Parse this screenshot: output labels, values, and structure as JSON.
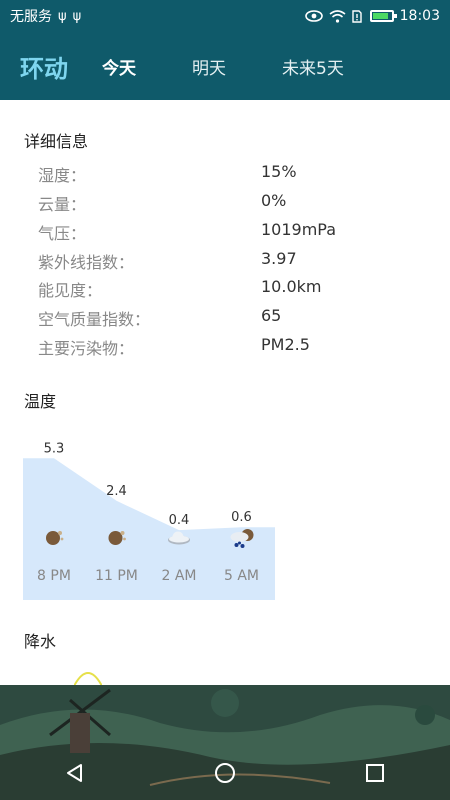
{
  "status_bar": {
    "carrier": "无服务",
    "time": "18:03",
    "battery_level": 0.85
  },
  "app_bar": {
    "app_name": "环动",
    "tabs": [
      {
        "label": "今天",
        "active": true
      },
      {
        "label": "明天",
        "active": false
      },
      {
        "label": "未来5天",
        "active": false
      }
    ]
  },
  "details": {
    "title": "详细信息",
    "rows": [
      {
        "label": "湿度：",
        "value": "15%"
      },
      {
        "label": "云量：",
        "value": "0%"
      },
      {
        "label": "气压：",
        "value": "1019mPa"
      },
      {
        "label": "紫外线指数：",
        "value": "3.97"
      },
      {
        "label": "能见度：",
        "value": "10.0km"
      },
      {
        "label": "空气质量指数：",
        "value": "65"
      },
      {
        "label": "主要污染物：",
        "value": "PM2.5"
      }
    ]
  },
  "temperature": {
    "title": "温度"
  },
  "chart_data": {
    "type": "area",
    "categories": [
      "8 PM",
      "11 PM",
      "2 AM",
      "5 AM"
    ],
    "values": [
      5.3,
      2.4,
      0.4,
      0.6
    ],
    "icons": [
      "rain-moon-icon",
      "rain-moon-icon",
      "cloud-icon",
      "snow-rain-icon"
    ],
    "fill_color": "#d6e8fb",
    "ylim": [
      -3,
      6
    ]
  },
  "precipitation": {
    "title": "降水"
  },
  "colors": {
    "header": "#0f5a6a",
    "logo": "#7fd6ef"
  }
}
